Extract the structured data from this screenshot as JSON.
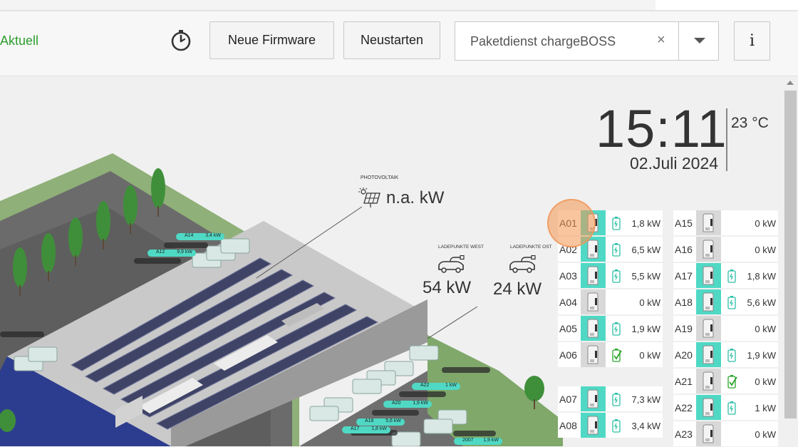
{
  "toolbar": {
    "status": "Aktuell",
    "firmware_label": "Neue Firmware",
    "restart_label": "Neustarten",
    "selected_site": "Paketdienst chargeBOSS",
    "clear_symbol": "×",
    "info_label": "i",
    "icons": {
      "timer": "timer-icon",
      "dropdown": "chevron-down-icon",
      "info": "info-icon"
    }
  },
  "clock": {
    "time": "15:11",
    "date": "02.Juli 2024",
    "temperature": "23 °C"
  },
  "photovoltaic": {
    "caption": "PHOTOVOLTAIK",
    "value": "n.a. kW"
  },
  "ladepunkte_west": {
    "caption": "LADEPUNKTE WEST",
    "value": "54 kW"
  },
  "ladepunkte_ost": {
    "caption": "LADEPUNKTE OST",
    "value": "24 kW"
  },
  "chargers_left": [
    {
      "code": "A01",
      "kw": "1,8 kW",
      "active": true,
      "battery": "charging"
    },
    {
      "code": "A02",
      "kw": "6,5 kW",
      "active": true,
      "battery": "charging"
    },
    {
      "code": "A03",
      "kw": "5,5 kW",
      "active": true,
      "battery": "charging"
    },
    {
      "code": "A04",
      "kw": "0 kW",
      "active": false,
      "battery": "none"
    },
    {
      "code": "A05",
      "kw": "1,9 kW",
      "active": true,
      "battery": "charging"
    },
    {
      "code": "A06",
      "kw": "0 kW",
      "active": false,
      "battery": "full"
    },
    {
      "code": "A07",
      "kw": "7,3 kW",
      "active": true,
      "battery": "charging"
    },
    {
      "code": "A08",
      "kw": "3,4 kW",
      "active": true,
      "battery": "charging"
    }
  ],
  "chargers_right": [
    {
      "code": "A15",
      "kw": "0 kW",
      "active": false,
      "battery": "none"
    },
    {
      "code": "A16",
      "kw": "0 kW",
      "active": false,
      "battery": "none"
    },
    {
      "code": "A17",
      "kw": "1,8 kW",
      "active": true,
      "battery": "charging"
    },
    {
      "code": "A18",
      "kw": "5,6 kW",
      "active": true,
      "battery": "charging"
    },
    {
      "code": "A19",
      "kw": "0 kW",
      "active": false,
      "battery": "none"
    },
    {
      "code": "A20",
      "kw": "1,9 kW",
      "active": true,
      "battery": "charging"
    },
    {
      "code": "A21",
      "kw": "0 kW",
      "active": false,
      "battery": "full"
    },
    {
      "code": "A22",
      "kw": "1 kW",
      "active": true,
      "battery": "charging"
    },
    {
      "code": "A23",
      "kw": "0 kW",
      "active": false,
      "battery": "none"
    }
  ],
  "map_labels": [
    {
      "code": "A14",
      "kw": "3,4 kW"
    },
    {
      "code": "A12",
      "kw": "9,9 kW"
    },
    {
      "code": "A22",
      "kw": "1 kW"
    },
    {
      "code": "A20",
      "kw": "1,9 kW"
    },
    {
      "code": "A18",
      "kw": "5,6 kW"
    },
    {
      "code": "A17",
      "kw": "1,8 kW"
    },
    {
      "code": "2007",
      "kw": "1,9 kW"
    }
  ],
  "colors": {
    "accent": "#4fd9c5",
    "status_green": "#2e9e2e",
    "roof": "#c8c8c8",
    "grass": "#7fa86a",
    "facade": "#2c3d8f"
  }
}
